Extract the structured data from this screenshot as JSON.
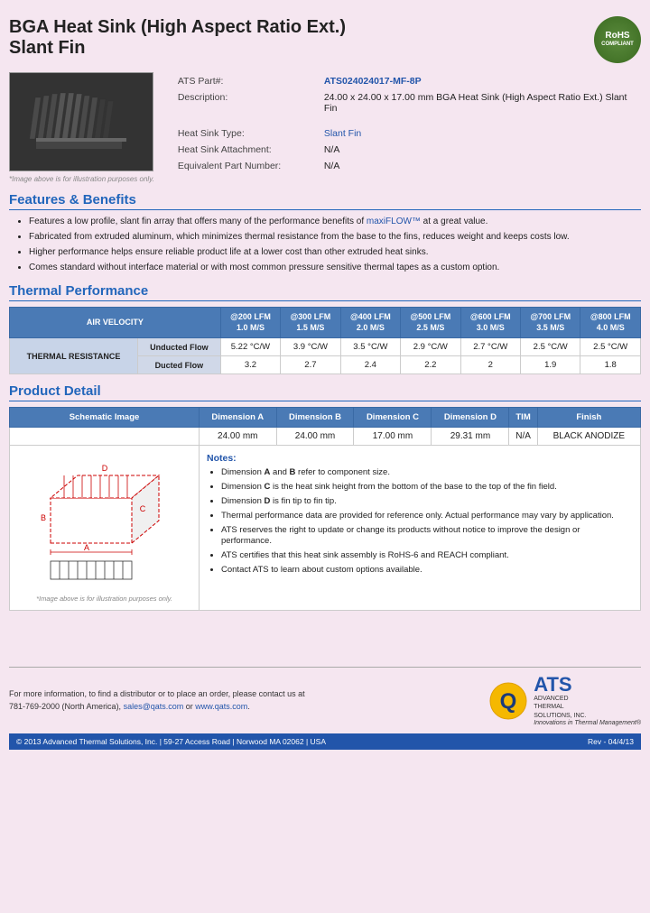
{
  "header": {
    "title_line1": "BGA Heat Sink (High Aspect Ratio Ext.)",
    "title_line2": "Slant Fin",
    "rohs": "RoHS\nCOMPLIANT"
  },
  "product": {
    "part_label": "ATS Part#:",
    "part_number": "ATS024024017-MF-8P",
    "description_label": "Description:",
    "description": "24.00 x 24.00 x 17.00 mm BGA Heat Sink (High Aspect Ratio Ext.) Slant Fin",
    "type_label": "Heat Sink Type:",
    "type_value": "Slant Fin",
    "attachment_label": "Heat Sink Attachment:",
    "attachment_value": "N/A",
    "equiv_label": "Equivalent Part Number:",
    "equiv_value": "N/A",
    "image_note": "*Image above is for illustration purposes only."
  },
  "features": {
    "title": "Features & Benefits",
    "items": [
      "Features a low profile, slant fin array that offers many of the performance benefits of maxiFLOW™ at a great value.",
      "Fabricated from extruded aluminum, which minimizes thermal resistance from the base to the fins, reduces weight and keeps costs low.",
      "Higher performance helps ensure reliable product life at a lower cost than other extruded heat sinks.",
      "Comes standard without interface material or with most common pressure sensitive thermal tapes as a custom option."
    ],
    "highlight": "maxiFLOW™"
  },
  "thermal": {
    "title": "Thermal Performance",
    "table": {
      "col_header_label": "AIR VELOCITY",
      "columns": [
        "@200 LFM\n1.0 M/S",
        "@300 LFM\n1.5 M/S",
        "@400 LFM\n2.0 M/S",
        "@500 LFM\n2.5 M/S",
        "@600 LFM\n3.0 M/S",
        "@700 LFM\n3.5 M/S",
        "@800 LFM\n4.0 M/S"
      ],
      "row_group_label": "THERMAL RESISTANCE",
      "rows": [
        {
          "label": "Unducted Flow",
          "values": [
            "5.22 °C/W",
            "3.9 °C/W",
            "3.5 °C/W",
            "2.9 °C/W",
            "2.7 °C/W",
            "2.5 °C/W",
            "2.5 °C/W"
          ]
        },
        {
          "label": "Ducted Flow",
          "values": [
            "3.2",
            "2.7",
            "2.4",
            "2.2",
            "2",
            "1.9",
            "1.8"
          ]
        }
      ]
    }
  },
  "product_detail": {
    "title": "Product Detail",
    "table_headers": [
      "Schematic Image",
      "Dimension A",
      "Dimension B",
      "Dimension C",
      "Dimension D",
      "TIM",
      "Finish"
    ],
    "dimension_values": [
      "24.00 mm",
      "24.00 mm",
      "17.00 mm",
      "29.31 mm",
      "N/A",
      "BLACK ANODIZE"
    ],
    "schematic_note": "*Image above is for illustration purposes only.",
    "notes_title": "Notes:",
    "notes": [
      "Dimension A and B refer to component size.",
      "Dimension C is the heat sink height from the bottom of the base to the top of the fin field.",
      "Dimension D is fin tip to fin tip.",
      "Thermal performance data are provided for reference only. Actual performance may vary by application.",
      "ATS reserves the right to update or change its products without notice to improve the design or performance.",
      "ATS certifies that this heat sink assembly is RoHS-6 and REACH compliant.",
      "Contact ATS to learn about custom options available."
    ]
  },
  "footer": {
    "contact_line1": "For more information, to find a distributor or to place an order, please contact us at",
    "contact_line2": "781-769-2000 (North America),",
    "contact_email": "sales@qats.com",
    "contact_or": " or ",
    "contact_web": "www.qats.com",
    "contact_period": ".",
    "copyright": "© 2013 Advanced Thermal Solutions, Inc.  |  59-27 Access Road  |  Norwood MA   02062  |  USA",
    "page_number": "Rev - 04/4/13",
    "ats_letters": "ATS",
    "ats_full1": "ADVANCED",
    "ats_full2": "THERMAL",
    "ats_full3": "SOLUTIONS, INC.",
    "ats_tagline": "Innovations in Thermal Management®"
  }
}
